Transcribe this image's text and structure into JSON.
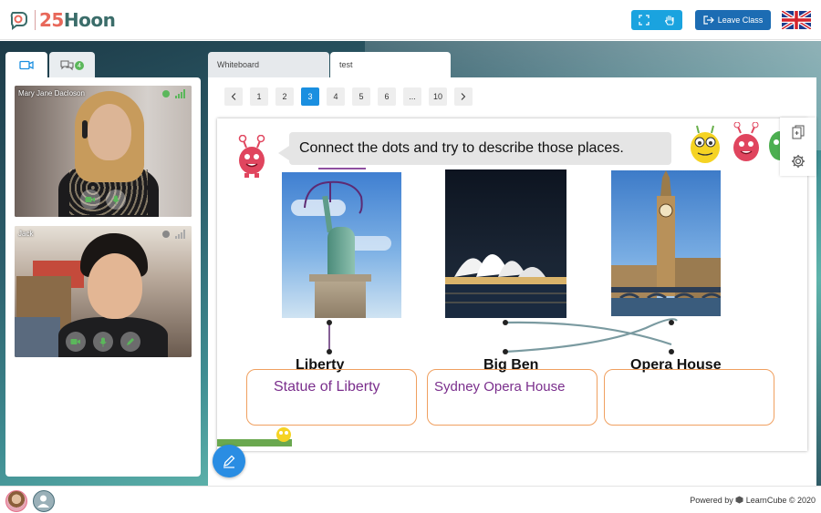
{
  "header": {
    "logo_text_num": "25",
    "logo_text_word": "Hoon",
    "leave_label": "Leave Class"
  },
  "left": {
    "chat_badge": "4",
    "videos": [
      {
        "name": "Mary Jane Dacloson",
        "status_color": "#5bb75b"
      },
      {
        "name": "Jack",
        "status_color": "#888888"
      }
    ]
  },
  "whiteboard": {
    "tabs": [
      "Whiteboard",
      "test"
    ],
    "pages": [
      "1",
      "2",
      "3",
      "4",
      "5",
      "6",
      "...",
      "10"
    ],
    "current_page": "3",
    "instruction": "Connect the dots and try to describe those places.",
    "words": [
      "Liberty",
      "Big Ben",
      "Opera House"
    ],
    "answers": [
      "Statue of Liberty",
      "Sydney Opera House",
      ""
    ]
  },
  "footer": {
    "powered_prefix": "Powered by",
    "powered_brand": "LearnCube © 2020"
  },
  "colors": {
    "accent": "#1a8fe0",
    "leave": "#1c6cb3",
    "answer_border": "#f0a060",
    "answer_text": "#7a2e8c"
  }
}
